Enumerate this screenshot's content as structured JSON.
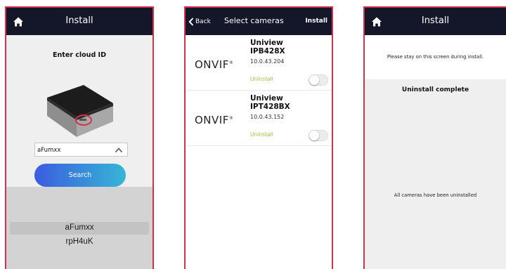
{
  "screen1": {
    "title": "Install",
    "enter_label": "Enter cloud ID",
    "cloud_id_value": "aFumxx",
    "search_label": "Search",
    "picker_options": [
      "aFumxx",
      "rpH4uK"
    ],
    "picker_selected": "aFumxx"
  },
  "screen2": {
    "back_label": "Back",
    "title": "Select cameras",
    "install_label": "Install",
    "cameras": [
      {
        "brand": "ONVIF",
        "name_line1": "Uniview",
        "name_line2": "IPB428X",
        "ip": "10.0.43.204",
        "action": "Uninstall",
        "enabled": false
      },
      {
        "brand": "ONVIF",
        "name_line1": "Uniview",
        "name_line2": "IPT428BX",
        "ip": "10.0.43.152",
        "action": "Uninstall",
        "enabled": false
      }
    ]
  },
  "screen3": {
    "title": "Install",
    "stay_message": "Please stay on this screen during install.",
    "complete_message": "Uninstall complete",
    "all_message": "All cameras have been uninstalled"
  },
  "icons": {
    "home": "home-icon",
    "back": "chevron-left-icon",
    "dropdown": "caret-up-icon"
  },
  "colors": {
    "topbar": "#14172a",
    "frame_border": "#d6304c",
    "accent_green": "#9fc13a",
    "search_gradient_start": "#3b5ce0",
    "search_gradient_end": "#36b6d6"
  }
}
